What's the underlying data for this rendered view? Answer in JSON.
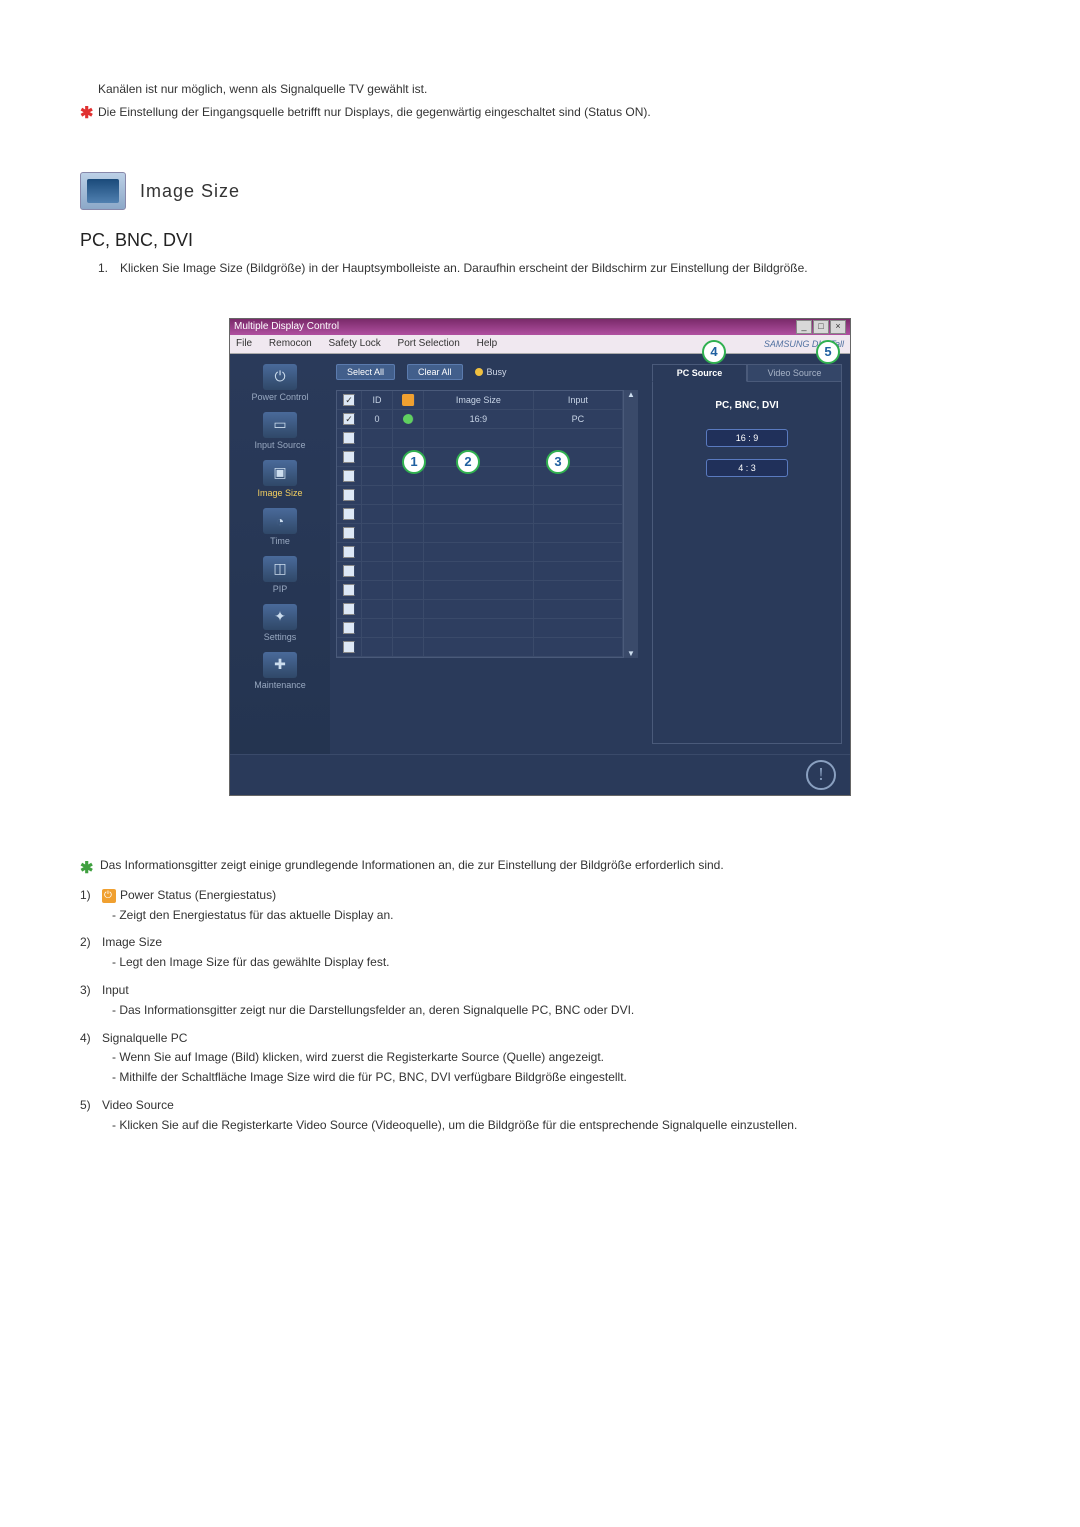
{
  "intro": {
    "line1": "Kanälen ist nur möglich, wenn als Signalquelle TV gewählt ist.",
    "line2": "Die Einstellung der Eingangsquelle betrifft nur Displays, die gegenwärtig eingeschaltet sind (Status ON)."
  },
  "section": {
    "title": "Image Size",
    "subtitle": "PC, BNC, DVI",
    "step1_num": "1.",
    "step1": "Klicken Sie Image Size (Bildgröße) in der Hauptsymbolleiste an. Daraufhin erscheint der Bildschirm zur Einstellung der Bildgröße."
  },
  "app": {
    "title": "Multiple Display Control",
    "menu": {
      "file": "File",
      "remocon": "Remocon",
      "safety": "Safety Lock",
      "port": "Port Selection",
      "help": "Help"
    },
    "brand": "SAMSUNG DIGITall",
    "toolbar": {
      "select_all": "Select All",
      "clear_all": "Clear All",
      "busy": "Busy"
    },
    "sidebar": {
      "power": "Power Control",
      "input": "Input Source",
      "image": "Image Size",
      "time": "Time",
      "pip": "PIP",
      "settings": "Settings",
      "maint": "Maintenance"
    },
    "grid": {
      "hdr_id": "ID",
      "hdr_img": "Image Size",
      "hdr_input": "Input",
      "row0_id": "0",
      "row0_img": "16:9",
      "row0_input": "PC"
    },
    "right": {
      "tab_pc": "PC Source",
      "tab_video": "Video Source",
      "panel_title": "PC, BNC, DVI",
      "btn_169": "16 : 9",
      "btn_43": "4 : 3"
    },
    "callouts": {
      "c1": "1",
      "c2": "2",
      "c3": "3",
      "c4": "4",
      "c5": "5"
    }
  },
  "desc": {
    "star": "Das Informationsgitter zeigt einige grundlegende Informationen an, die zur Einstellung der Bildgröße erforderlich sind.",
    "d1_n": "1)",
    "d1_title": "Power Status (Energiestatus)",
    "d1_sub": "- Zeigt den Energiestatus für das aktuelle Display an.",
    "d2_n": "2)",
    "d2_title": "Image Size",
    "d2_sub": "- Legt den Image Size für das gewählte Display fest.",
    "d3_n": "3)",
    "d3_title": "Input",
    "d3_sub": "- Das Informationsgitter zeigt nur die Darstellungsfelder an, deren Signalquelle PC, BNC oder DVI.",
    "d4_n": "4)",
    "d4_title": "Signalquelle PC",
    "d4_sub1": "- Wenn Sie auf Image (Bild) klicken, wird zuerst die Registerkarte Source (Quelle) angezeigt.",
    "d4_sub2": "- Mithilfe der Schaltfläche Image Size wird die für PC, BNC, DVI verfügbare Bildgröße eingestellt.",
    "d5_n": "5)",
    "d5_title": "Video Source",
    "d5_sub": "- Klicken Sie auf die Registerkarte Video Source (Videoquelle), um die Bildgröße für die entsprechende Signalquelle einzustellen."
  }
}
